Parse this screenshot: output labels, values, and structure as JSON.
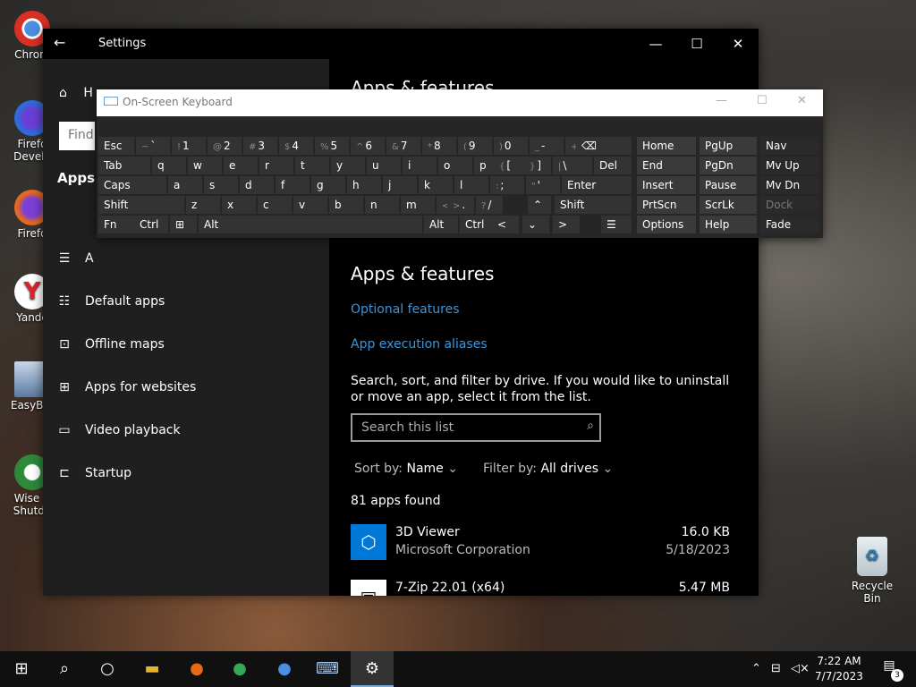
{
  "desktop": {
    "icons": [
      {
        "label": "Chrom",
        "color": "#4a8fe0"
      },
      {
        "label": "Firefo Develo",
        "color": "#2f6bd9"
      },
      {
        "label": "Firefo",
        "color": "#e66a1a"
      },
      {
        "label": "Yande",
        "color": "#e0232a"
      },
      {
        "label": "EasyBCI",
        "color": "#5a7aa0"
      },
      {
        "label": "Wise A Shutdo",
        "color": "#2e8a3a"
      }
    ],
    "recycle_bin": "Recycle Bin"
  },
  "settings": {
    "title": "Settings",
    "back_icon": "back-arrow-icon",
    "controls": {
      "minimize": "—",
      "maximize": "☐",
      "close": "✕"
    },
    "sidebar": {
      "home": "H",
      "find_placeholder": "Find",
      "section_title": "Apps",
      "items": [
        {
          "label": "A",
          "icon": "apps-features-icon"
        },
        {
          "label": "Default apps",
          "icon": "default-apps-icon"
        },
        {
          "label": "Offline maps",
          "icon": "offline-maps-icon"
        },
        {
          "label": "Apps for websites",
          "icon": "apps-websites-icon"
        },
        {
          "label": "Video playback",
          "icon": "video-playback-icon"
        },
        {
          "label": "Startup",
          "icon": "startup-icon"
        }
      ]
    },
    "content": {
      "partial_heading": "Apps & features",
      "heading": "Apps & features",
      "optional_features": "Optional features",
      "execution_aliases": "App execution aliases",
      "description": "Search, sort, and filter by drive. If you would like to uninstall or move an app, select it from the list.",
      "search_placeholder": "Search this list",
      "sort_label": "Sort by:",
      "sort_value": "Name",
      "filter_label": "Filter by:",
      "filter_value": "All drives",
      "count": "81 apps found",
      "apps": [
        {
          "name": "3D Viewer",
          "publisher": "Microsoft Corporation",
          "size": "16.0 KB",
          "date": "5/18/2023"
        },
        {
          "name": "7-Zip 22.01 (x64)",
          "publisher": "",
          "size": "5.47 MB",
          "date": ""
        }
      ]
    }
  },
  "osk": {
    "title": "On-Screen Keyboard",
    "controls": {
      "minimize": "—",
      "maximize": "☐",
      "close": "✕"
    },
    "rows": [
      [
        {
          "l": "Esc"
        },
        {
          "s": "~",
          "l": "`"
        },
        {
          "s": "!",
          "l": "1"
        },
        {
          "s": "@",
          "l": "2"
        },
        {
          "s": "#",
          "l": "3"
        },
        {
          "s": "$",
          "l": "4"
        },
        {
          "s": "%",
          "l": "5"
        },
        {
          "s": "^",
          "l": "6"
        },
        {
          "s": "&",
          "l": "7"
        },
        {
          "s": "*",
          "l": "8"
        },
        {
          "s": "(",
          "l": "9"
        },
        {
          "s": ")",
          "l": "0"
        },
        {
          "s": "_",
          "l": "-"
        },
        {
          "s": "+",
          "l": "="
        },
        {
          "l": "⌫"
        }
      ],
      [
        {
          "l": "Tab"
        },
        {
          "l": "q"
        },
        {
          "l": "w"
        },
        {
          "l": "e"
        },
        {
          "l": "r"
        },
        {
          "l": "t"
        },
        {
          "l": "y"
        },
        {
          "l": "u"
        },
        {
          "l": "i"
        },
        {
          "l": "o"
        },
        {
          "l": "p"
        },
        {
          "s": "{",
          "l": "["
        },
        {
          "s": "}",
          "l": "]"
        },
        {
          "s": "|",
          "l": "\\"
        },
        {
          "l": "Del"
        }
      ],
      [
        {
          "l": "Caps"
        },
        {
          "l": "a"
        },
        {
          "l": "s"
        },
        {
          "l": "d"
        },
        {
          "l": "f"
        },
        {
          "l": "g"
        },
        {
          "l": "h"
        },
        {
          "l": "j"
        },
        {
          "l": "k"
        },
        {
          "l": "l"
        },
        {
          "s": ":",
          "l": ";"
        },
        {
          "s": "\"",
          "l": "'"
        },
        {
          "l": "Enter"
        }
      ],
      [
        {
          "l": "Shift"
        },
        {
          "l": "z"
        },
        {
          "l": "x"
        },
        {
          "l": "c"
        },
        {
          "l": "v"
        },
        {
          "l": "b"
        },
        {
          "l": "n"
        },
        {
          "l": "m"
        },
        {
          "s": "<",
          "l": ","
        },
        {
          "s": ">",
          "l": "."
        },
        {
          "s": "?",
          "l": "/"
        },
        {
          "l": "⌃"
        },
        {
          "l": "Shift"
        }
      ],
      [
        {
          "l": "Fn"
        },
        {
          "l": "Ctrl"
        },
        {
          "l": "⊞"
        },
        {
          "l": "Alt"
        },
        {
          "l": ""
        },
        {
          "l": "Alt"
        },
        {
          "l": "Ctrl"
        },
        {
          "l": "<"
        },
        {
          "l": "⌄"
        },
        {
          "l": ">"
        },
        {
          "l": "☰"
        }
      ]
    ],
    "side_rows": [
      [
        "Home",
        "PgUp",
        "Nav"
      ],
      [
        "End",
        "PgDn",
        "Mv Up"
      ],
      [
        "Insert",
        "Pause",
        "Mv Dn"
      ],
      [
        "PrtScn",
        "ScrLk",
        "Dock"
      ],
      [
        "Options",
        "Help",
        "Fade"
      ]
    ]
  },
  "taskbar": {
    "items": [
      {
        "name": "start-icon",
        "glyph": "⊞"
      },
      {
        "name": "search-icon",
        "glyph": "⌕"
      },
      {
        "name": "task-view-icon",
        "glyph": "○"
      },
      {
        "name": "file-explorer-icon",
        "glyph": "▬"
      },
      {
        "name": "firefox-icon",
        "glyph": "●"
      },
      {
        "name": "chrome-icon",
        "glyph": "●"
      },
      {
        "name": "chrome-alt-icon",
        "glyph": "●"
      },
      {
        "name": "on-screen-keyboard-icon",
        "glyph": "⌨"
      },
      {
        "name": "settings-icon",
        "glyph": "⚙"
      }
    ],
    "time": "7:22 AM",
    "date": "7/7/2023",
    "notifications": "3"
  }
}
